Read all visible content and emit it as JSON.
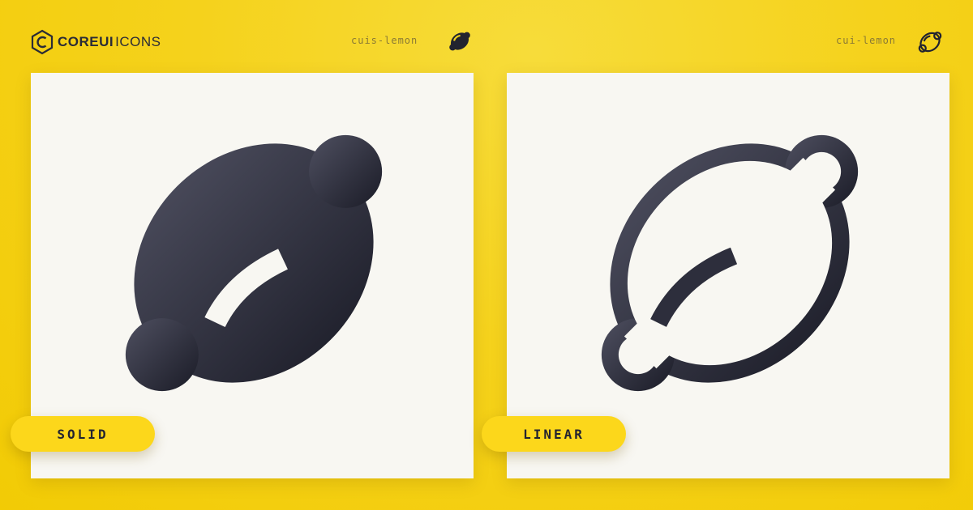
{
  "brand": {
    "core": "COREUI",
    "icons": "ICONS"
  },
  "colors": {
    "background": "#f5d21c",
    "card": "#f8f7f2",
    "icon_dark": "#2a2b38",
    "pill": "#fcd71b"
  },
  "panels": [
    {
      "icon_name": "cuis-lemon",
      "label": "SOLID",
      "style": "solid",
      "icon": "lemon-solid-icon"
    },
    {
      "icon_name": "cui-lemon",
      "label": "LINEAR",
      "style": "linear",
      "icon": "lemon-linear-icon"
    }
  ]
}
